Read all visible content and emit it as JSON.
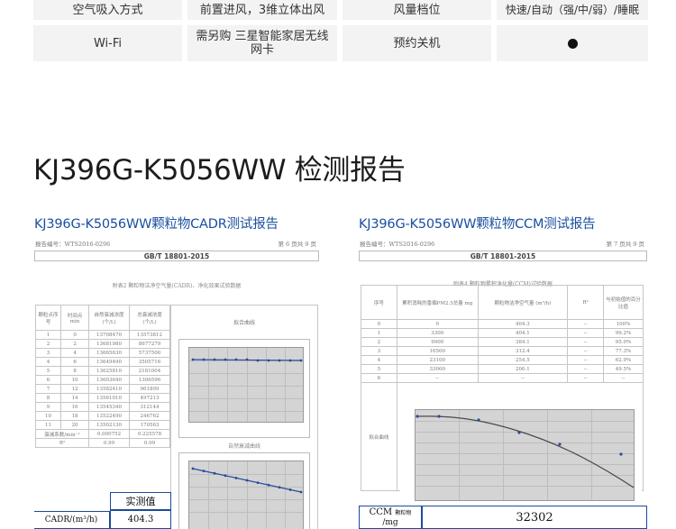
{
  "spec": {
    "row1": [
      "空气吸入方式",
      "前置进风，3维立体出风",
      "风量档位",
      "快速/自动（强/中/弱）/睡眠"
    ],
    "row2": [
      "Wi-Fi",
      "需另购 三星智能家居无线网卡",
      "预约关机",
      "●"
    ]
  },
  "section_title": "KJ396G-K5056WW 检测报告",
  "reports": {
    "left": {
      "heading": "KJ396G-K5056WW颗粒物CADR测试报告",
      "report_no": "报告编号：WTS2016-0296",
      "page": "第 6 页共 9 页",
      "standard": "GB/T 18801-2015",
      "caption": "附表2  颗粒物洁净空气量(CADR)、净化效果试验数据",
      "table_headers": [
        "颗粒点序号",
        "时间点 min",
        "自然衰减浓度(个/L)",
        "总衰减浓度(个/L)",
        "拟合曲线"
      ],
      "table_rows": [
        [
          "1",
          "0",
          "13708470",
          "13573812"
        ],
        [
          "2",
          "2",
          "13681980",
          "8677279"
        ],
        [
          "3",
          "4",
          "13665630",
          "5737500"
        ],
        [
          "4",
          "6",
          "13649490",
          "3505716"
        ],
        [
          "5",
          "8",
          "13625810",
          "2181004"
        ],
        [
          "6",
          "10",
          "13603640",
          "1306596"
        ],
        [
          "7",
          "12",
          "13582410",
          "961809"
        ],
        [
          "8",
          "14",
          "13561010",
          "497213"
        ],
        [
          "9",
          "16",
          "13545340",
          "312144"
        ],
        [
          "10",
          "18",
          "13522490",
          "246762"
        ],
        [
          "11",
          "20",
          "13502130",
          "170563"
        ]
      ],
      "decay_row": [
        "衰减系数/min⁻¹",
        "0.000752",
        "0.225578"
      ],
      "r2_row": [
        "R²",
        "0.99",
        "0.99"
      ],
      "sub_caption": "自然衰减曲线",
      "cadr_label": "CADR/(m³/h)",
      "measured_label": "实测值",
      "measured_value": "404.3"
    },
    "right": {
      "heading": "KJ396G-K5056WW颗粒物CCM测试报告",
      "report_no": "报告编号：WTS2016-0296",
      "page": "第 7 页共 9 页",
      "standard": "GB/T 18801-2015",
      "caption": "附表4  颗粒物累积净化量(CCM)试验数据",
      "table_headers": [
        "序号",
        "累积消耗的香烟PM2.5总量 mg",
        "颗粒物洁净空气量 (m³/h)",
        "R²",
        "与初始值的百分比值"
      ],
      "table_rows": [
        [
          "0",
          "0",
          "404.3",
          "--",
          "100%"
        ],
        [
          "1",
          "3300",
          "404.1",
          "--",
          "99.2%"
        ],
        [
          "2",
          "9900",
          "384.1",
          "--",
          "95.0%"
        ],
        [
          "3",
          "16500",
          "312.4",
          "--",
          "77.3%"
        ],
        [
          "4",
          "23100",
          "254.5",
          "--",
          "62.9%"
        ],
        [
          "5",
          "33000",
          "200.1",
          "--",
          "49.5%"
        ],
        [
          "6",
          "--",
          "--",
          "--",
          "--"
        ]
      ],
      "fit_label": "拟合曲线",
      "ccm_label_main": "CCM",
      "ccm_label_sub": "颗粒物",
      "ccm_label_unit": "/mg",
      "ccm_value": "32302"
    }
  }
}
